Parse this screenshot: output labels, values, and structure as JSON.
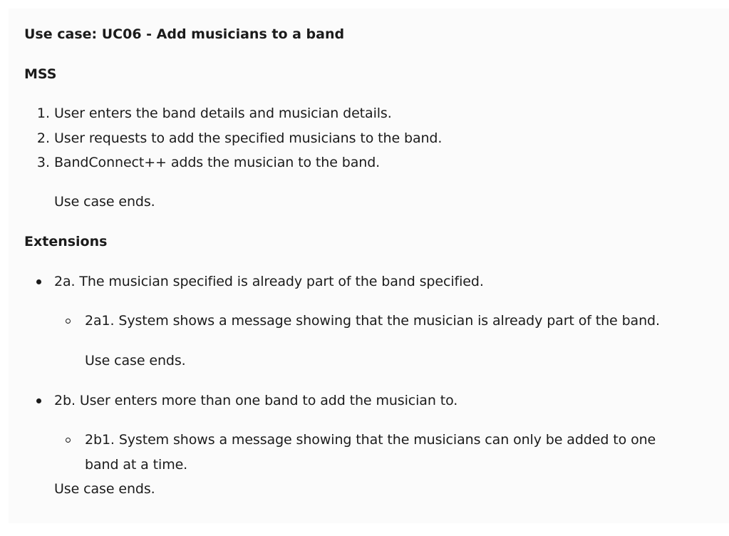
{
  "title": "Use case: UC06 - Add musicians to a band",
  "mss_heading": "MSS",
  "mss_steps": [
    {
      "number": "1.",
      "text": "User enters the band details and musician details."
    },
    {
      "number": "2.",
      "text": "User requests to add the specified musicians to the band."
    },
    {
      "number": "3.",
      "text": "BandConnect++ adds the musician to the band."
    }
  ],
  "mss_end": "Use case ends.",
  "extensions_heading": "Extensions",
  "extensions": [
    {
      "text": "2a. The musician specified is already part of the band specified.",
      "sub": {
        "lines": [
          "2a1. System shows a message showing that the musician is already part of the band."
        ],
        "end": "Use case ends."
      }
    },
    {
      "text": "2b. User enters more than one band to add the musician to.",
      "sub": {
        "lines": [
          "2b1. System shows a message showing that the musicians can only be added to one",
          "band at a time."
        ],
        "end": "Use case ends."
      }
    }
  ]
}
